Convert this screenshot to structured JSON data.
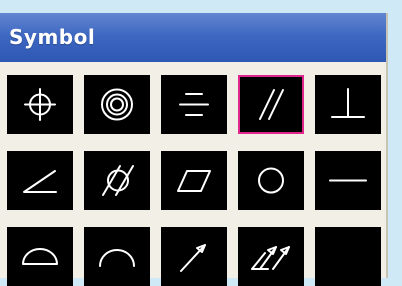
{
  "panel": {
    "title": "Symbol"
  },
  "colors": {
    "title_bar": "#3f68c2",
    "panel_bg": "#f1efe6",
    "cell_bg": "#000000",
    "symbol_stroke": "#ffffff",
    "selection_border": "#e0258c",
    "page_bg": "#cfe9f7"
  },
  "symbols": [
    {
      "icon": "position-icon",
      "selected": false
    },
    {
      "icon": "concentricity-icon",
      "selected": false
    },
    {
      "icon": "symmetry-icon",
      "selected": false
    },
    {
      "icon": "parallelism-icon",
      "selected": true
    },
    {
      "icon": "perpendicularity-icon",
      "selected": false
    },
    {
      "icon": "angularity-icon",
      "selected": false
    },
    {
      "icon": "cylindricity-icon",
      "selected": false
    },
    {
      "icon": "flatness-icon",
      "selected": false
    },
    {
      "icon": "circularity-icon",
      "selected": false
    },
    {
      "icon": "straightness-icon",
      "selected": false
    },
    {
      "icon": "profile-of-surface-icon",
      "selected": false
    },
    {
      "icon": "profile-of-line-icon",
      "selected": false
    },
    {
      "icon": "circular-runout-icon",
      "selected": false
    },
    {
      "icon": "total-runout-icon",
      "selected": false
    },
    {
      "icon": "blank-symbol-icon",
      "selected": false
    }
  ]
}
